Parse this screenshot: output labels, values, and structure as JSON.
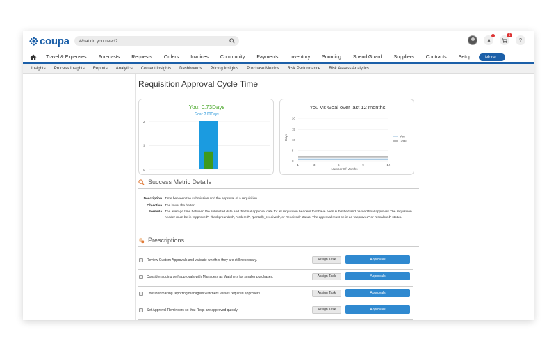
{
  "header": {
    "logo_text": "coupa",
    "search_placeholder": "What do you need?",
    "notification_badge": "1",
    "help_label": "?"
  },
  "nav": {
    "items": [
      "Travel & Expenses",
      "Forecasts",
      "Requests",
      "Orders",
      "Invoices",
      "Community",
      "Payments",
      "Inventory",
      "Sourcing",
      "Spend Guard",
      "Suppliers",
      "Contracts",
      "Setup"
    ],
    "more_label": "More..."
  },
  "subnav": {
    "items": [
      "Insights",
      "Process Insights",
      "Reports",
      "Analytics",
      "Content Insights",
      "Dashboards",
      "Pricing Insights",
      "Purchase Metrics",
      "Risk Performance",
      "Risk Assess Analytics"
    ]
  },
  "page": {
    "title": "Requisition Approval Cycle Time"
  },
  "kpi": {
    "value_label": "You: 0.73Days",
    "goal_label": "Goal: 2.00Days"
  },
  "trend": {
    "title": "You Vs Goal over last 12 months"
  },
  "chart_data": [
    {
      "type": "bar",
      "categories": [
        ""
      ],
      "series": [
        {
          "name": "Goal",
          "values": [
            2.0
          ],
          "color": "#1b9be0"
        },
        {
          "name": "You",
          "values": [
            0.73
          ],
          "color": "#3f9a1d"
        }
      ],
      "yticks": [
        "0",
        "1",
        "2"
      ],
      "ylim": [
        0,
        2
      ]
    },
    {
      "type": "line",
      "x": [
        1,
        2,
        3,
        4,
        5,
        6,
        7,
        8,
        9,
        10,
        11,
        12
      ],
      "series": [
        {
          "name": "You",
          "values": [
            0.9,
            0.9,
            0.9,
            0.9,
            0.9,
            0.9,
            0.9,
            0.9,
            0.9,
            0.9,
            0.9,
            0.9
          ],
          "color": "#8fb8d8"
        },
        {
          "name": "Goal",
          "values": [
            2,
            2,
            2,
            2,
            2,
            2,
            2,
            2,
            2,
            2,
            2,
            2
          ],
          "color": "#777777"
        }
      ],
      "xticks": [
        "1",
        "3",
        "6",
        "9",
        "12"
      ],
      "yticks": [
        "0",
        "5",
        "10",
        "15",
        "20"
      ],
      "ylim": [
        0,
        20
      ],
      "xlabel": "Number Of Months",
      "ylabel": "Days",
      "legend": "right"
    }
  ],
  "metric": {
    "heading": "Success Metric Details",
    "description_label": "Description",
    "description": "Time between the submission and the approval of a requisition.",
    "objective_label": "Objective",
    "objective": "The lower the better",
    "formula_label": "Formula",
    "formula": "The average time between the submitted date and the final approval date for all requisition headers that have been submitted and passed final approval. The requisition header must be in \"approved\", \"backgrounded\", \"ordered\", \"partially_received\", or \"received\" status. The approval must be in an \"approved\" or \"escalated\" status."
  },
  "prescriptions": {
    "heading": "Prescriptions",
    "assign_label": "Assign Task",
    "approve_label": "Approvals",
    "items": [
      "Review Custom Approvals and validate whether they are still necessary.",
      "Consider adding self-approvals with Managers as Watchers for smaller purchases.",
      "Consider making reporting managers watchers verses required approvers.",
      "Set Approval Reminders so that Reqs are approved quickly."
    ]
  }
}
